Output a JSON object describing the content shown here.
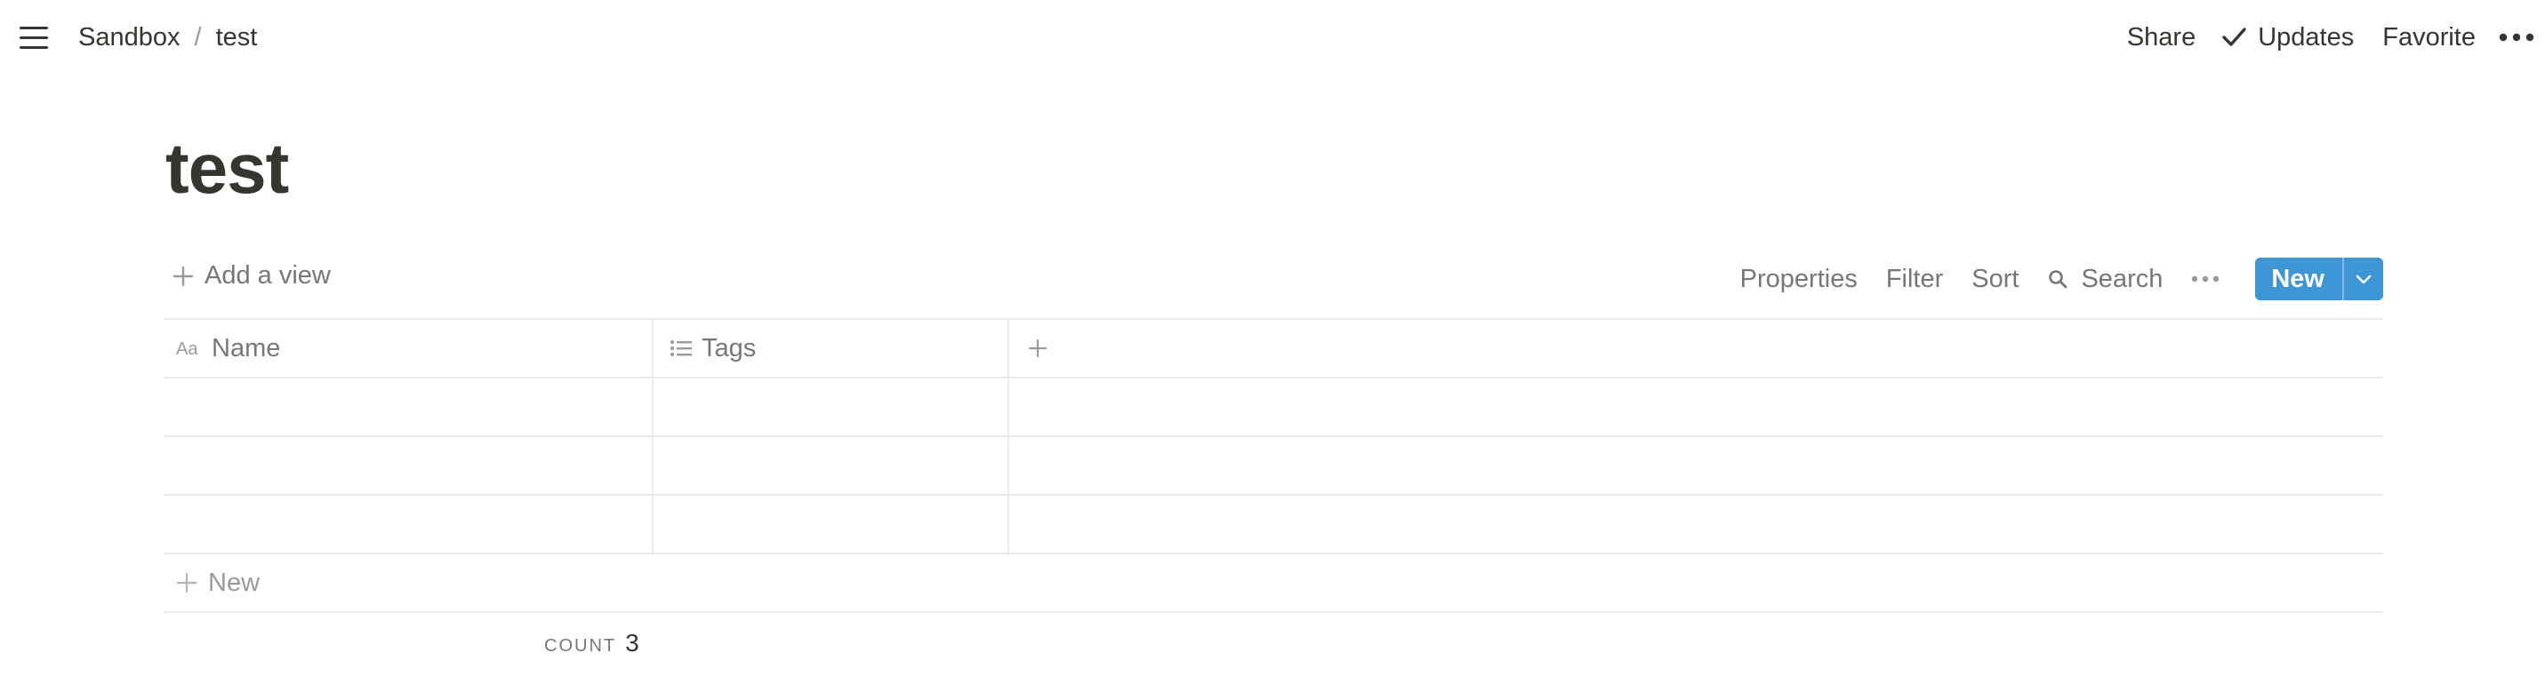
{
  "topbar": {
    "breadcrumb": [
      "Sandbox",
      "test"
    ],
    "breadcrumb_separator": "/",
    "share_label": "Share",
    "updates_label": "Updates",
    "favorite_label": "Favorite"
  },
  "page": {
    "title": "test"
  },
  "viewbar": {
    "add_view_label": "Add a view",
    "properties_label": "Properties",
    "filter_label": "Filter",
    "sort_label": "Sort",
    "search_label": "Search",
    "new_label": "New"
  },
  "table": {
    "columns": [
      {
        "label": "Name",
        "icon": "text-property-icon"
      },
      {
        "label": "Tags",
        "icon": "list-property-icon"
      }
    ],
    "rows": [
      {
        "name": "",
        "tags": ""
      },
      {
        "name": "",
        "tags": ""
      },
      {
        "name": "",
        "tags": ""
      }
    ],
    "new_row_label": "New"
  },
  "footer": {
    "count_label": "COUNT",
    "count_value": "3"
  },
  "colors": {
    "accent": "#3f96d6",
    "text": "#37352f",
    "muted": "#787774",
    "border": "#e9e9e7"
  }
}
